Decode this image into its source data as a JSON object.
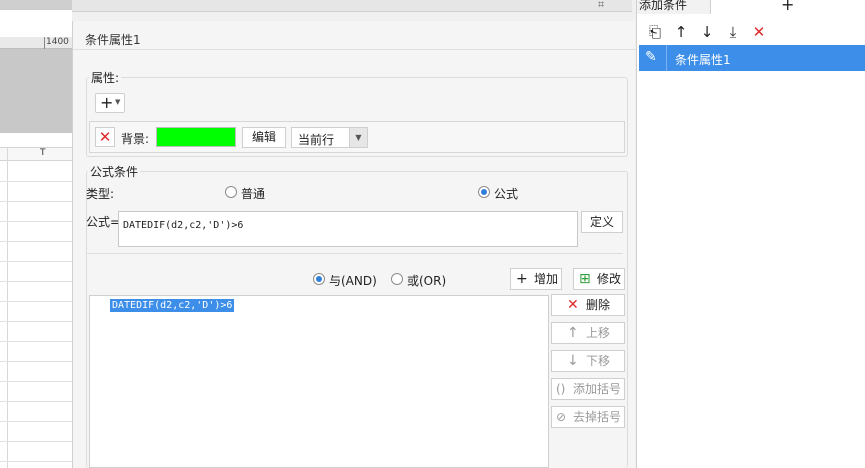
{
  "background_sheet": {
    "ruler_label": "1400",
    "column_label": "T"
  },
  "dialog": {
    "title": "条件属性1",
    "properties": {
      "group_label": "属性:",
      "add_symbol": "+",
      "background_label": "背景:",
      "background_color": "#00ff00",
      "edit_label": "编辑",
      "scope_value": "当前行"
    },
    "formula_condition": {
      "group_label": "公式条件",
      "type_label": "类型:",
      "option_normal": "普通",
      "option_formula": "公式",
      "selected_type": "公式",
      "formula_label": "公式=",
      "formula_value": "DATEDIF(d2,c2,'D')>6",
      "define_label": "定义"
    },
    "logic": {
      "and_label": "与(AND)",
      "or_label": "或(OR)",
      "selected": "AND",
      "add_label": "增加",
      "modify_label": "修改"
    },
    "condition_list": {
      "items": [
        "DATEDIF(d2,c2,'D')>6"
      ]
    },
    "side_buttons": {
      "delete_label": "删除",
      "move_up_label": "上移",
      "move_down_label": "下移",
      "add_bracket_label": "添加括号",
      "remove_bracket_label": "去掉括号"
    }
  },
  "right_panel": {
    "tab_label": "添加条件",
    "add_symbol": "+",
    "items": [
      {
        "label": "条件属性1",
        "selected": true
      }
    ]
  },
  "colors": {
    "accent": "#3d8ee8",
    "delete_red": "#e02b2b",
    "background_swatch": "#00ff00"
  }
}
